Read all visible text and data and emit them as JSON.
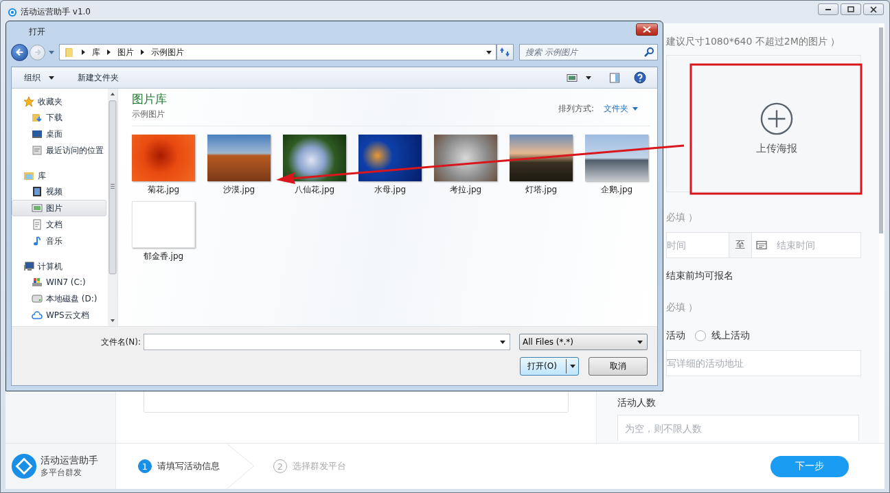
{
  "app": {
    "title": "活动运营助手 v1.0"
  },
  "form": {
    "poster_hint": "建议尺寸1080*640 不超过2M的图片 ）",
    "upload_label": "上传海报",
    "time_required": "必填 ）",
    "start_time_placeholder": "时间",
    "range_separator": "至",
    "end_time_placeholder": "结束时间",
    "signup_note": "结束前均可报名",
    "location_required": "必填 ）",
    "location_partial_option": "活动",
    "location_option": {
      "label": "线上活动",
      "selected": false
    },
    "address_placeholder": "写详细的活动地址",
    "people_label": "活动人数",
    "people_placeholder": "为空，则不限人数"
  },
  "footer": {
    "brand": "活动运营助手",
    "tagline": "多平台群发",
    "steps": [
      {
        "number": "1",
        "label": "请填写活动信息",
        "selected": true
      },
      {
        "number": "2",
        "label": "选择群发平台",
        "selected": false
      }
    ],
    "next_button": "下一步"
  },
  "dialog": {
    "title": "打开",
    "breadcrumb": [
      "库",
      "图片",
      "示例图片"
    ],
    "search_placeholder": "搜索 示例图片",
    "organize": "组织",
    "new_folder": "新建文件夹",
    "nav": [
      {
        "label": "收藏夹",
        "items": [
          {
            "label": "下载",
            "selected": false
          },
          {
            "label": "桌面",
            "selected": false
          },
          {
            "label": "最近访问的位置",
            "selected": false
          }
        ]
      },
      {
        "label": "库",
        "items": [
          {
            "label": "视频",
            "selected": false
          },
          {
            "label": "图片",
            "selected": true
          },
          {
            "label": "文档",
            "selected": false
          },
          {
            "label": "音乐",
            "selected": false
          }
        ]
      },
      {
        "label": "计算机",
        "items": [
          {
            "label": "WIN7 (C:)",
            "selected": false
          },
          {
            "label": "本地磁盘 (D:)",
            "selected": false
          },
          {
            "label": "WPS云文档",
            "selected": false
          }
        ]
      }
    ],
    "library_title": "图片库",
    "library_subtitle": "示例图片",
    "sort_label": "排列方式:",
    "sort_value": "文件夹",
    "files": [
      {
        "name": "菊花.jpg"
      },
      {
        "name": "沙漠.jpg"
      },
      {
        "name": "八仙花.jpg"
      },
      {
        "name": "水母.jpg"
      },
      {
        "name": "考拉.jpg"
      },
      {
        "name": "灯塔.jpg"
      },
      {
        "name": "企鹅.jpg"
      },
      {
        "name": "郁金香.jpg"
      }
    ],
    "filename_label": "文件名(N):",
    "file_type": "All Files (*.*)",
    "open_button": "打开(O)",
    "cancel_button": "取消"
  }
}
